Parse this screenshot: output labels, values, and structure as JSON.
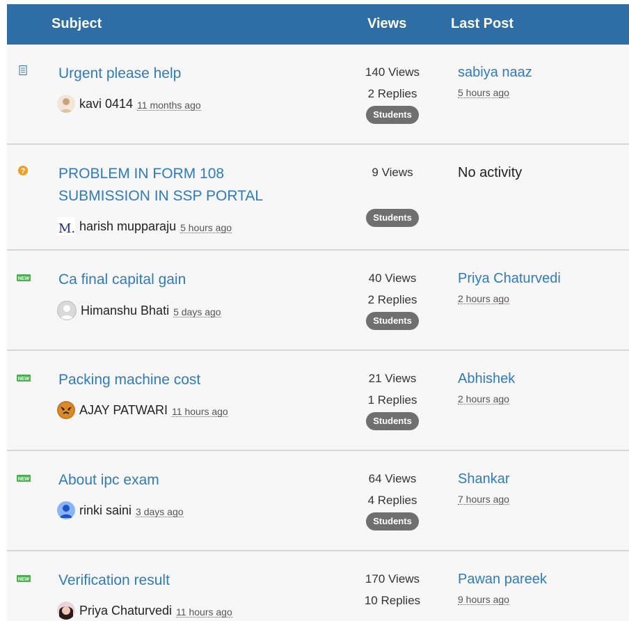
{
  "header": {
    "subject": "Subject",
    "views": "Views",
    "last_post": "Last Post"
  },
  "colors": {
    "header_bg": "#2f6ea4",
    "link": "#2e7bbf",
    "badge": "#6f6f6f",
    "row_bg": "#f7f7f7",
    "new_icon": "#4caf50",
    "question_icon": "#f0a020"
  },
  "topics": [
    {
      "icon": "document-icon",
      "title": "Urgent please help",
      "author": "kavi 0414",
      "time": "11 months ago",
      "views": "140 Views",
      "replies": "2 Replies",
      "badge": "Students",
      "last_name": "sabiya naaz",
      "last_time": "5 hours ago"
    },
    {
      "icon": "question-icon",
      "title": "PROBLEM IN FORM 108 SUBMISSION IN SSP PORTAL",
      "author": "harish mupparaju",
      "time": "5 hours ago",
      "views": "9 Views",
      "replies": "",
      "badge": "Students",
      "last_name": "",
      "last_text": "No activity",
      "last_time": ""
    },
    {
      "icon": "new-icon",
      "title": "Ca final capital gain",
      "author": "Himanshu Bhati",
      "time": "5 days ago",
      "views": "40 Views",
      "replies": "2 Replies",
      "badge": "Students",
      "last_name": "Priya Chaturvedi",
      "last_time": "2 hours ago"
    },
    {
      "icon": "new-icon",
      "title": "Packing machine cost",
      "author": "AJAY PATWARI",
      "time": "11 hours ago",
      "views": "21 Views",
      "replies": "1 Replies",
      "badge": "Students",
      "last_name": "Abhishek",
      "last_time": "2 hours ago"
    },
    {
      "icon": "new-icon",
      "title": "About ipc exam",
      "author": "rinki saini",
      "time": "3 days ago",
      "views": "64 Views",
      "replies": "4 Replies",
      "badge": "Students",
      "last_name": "Shankar",
      "last_time": "7 hours ago"
    },
    {
      "icon": "new-icon",
      "title": "Verification result",
      "author": "Priya Chaturvedi",
      "time": "11 hours ago",
      "views": "170 Views",
      "replies": "10 Replies",
      "badge": "",
      "last_name": "Pawan pareek",
      "last_time": "9 hours ago"
    }
  ],
  "icon_text": {
    "new": "NEW",
    "question": "?",
    "avatar_letter": "M."
  }
}
